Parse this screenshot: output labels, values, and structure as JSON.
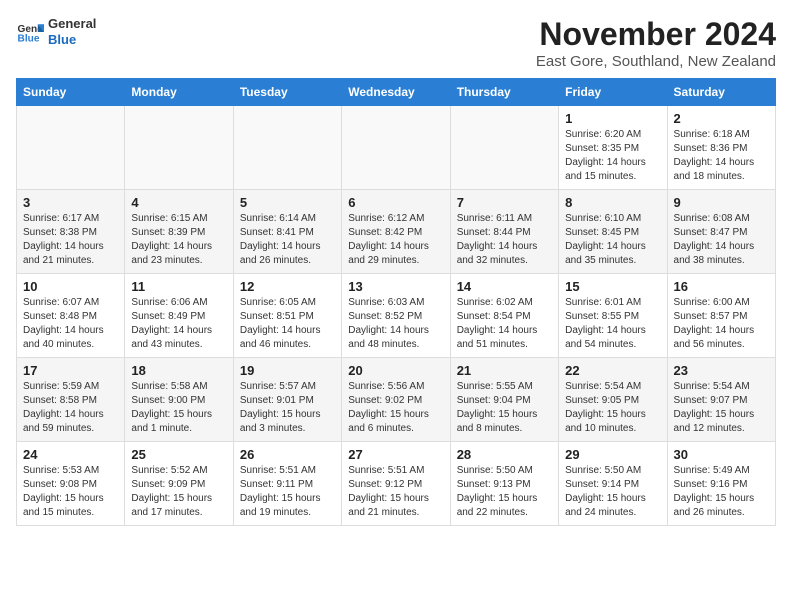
{
  "logo": {
    "line1": "General",
    "line2": "Blue"
  },
  "title": "November 2024",
  "subtitle": "East Gore, Southland, New Zealand",
  "days_header": [
    "Sunday",
    "Monday",
    "Tuesday",
    "Wednesday",
    "Thursday",
    "Friday",
    "Saturday"
  ],
  "weeks": [
    [
      {
        "day": "",
        "info": ""
      },
      {
        "day": "",
        "info": ""
      },
      {
        "day": "",
        "info": ""
      },
      {
        "day": "",
        "info": ""
      },
      {
        "day": "",
        "info": ""
      },
      {
        "day": "1",
        "info": "Sunrise: 6:20 AM\nSunset: 8:35 PM\nDaylight: 14 hours and 15 minutes."
      },
      {
        "day": "2",
        "info": "Sunrise: 6:18 AM\nSunset: 8:36 PM\nDaylight: 14 hours and 18 minutes."
      }
    ],
    [
      {
        "day": "3",
        "info": "Sunrise: 6:17 AM\nSunset: 8:38 PM\nDaylight: 14 hours and 21 minutes."
      },
      {
        "day": "4",
        "info": "Sunrise: 6:15 AM\nSunset: 8:39 PM\nDaylight: 14 hours and 23 minutes."
      },
      {
        "day": "5",
        "info": "Sunrise: 6:14 AM\nSunset: 8:41 PM\nDaylight: 14 hours and 26 minutes."
      },
      {
        "day": "6",
        "info": "Sunrise: 6:12 AM\nSunset: 8:42 PM\nDaylight: 14 hours and 29 minutes."
      },
      {
        "day": "7",
        "info": "Sunrise: 6:11 AM\nSunset: 8:44 PM\nDaylight: 14 hours and 32 minutes."
      },
      {
        "day": "8",
        "info": "Sunrise: 6:10 AM\nSunset: 8:45 PM\nDaylight: 14 hours and 35 minutes."
      },
      {
        "day": "9",
        "info": "Sunrise: 6:08 AM\nSunset: 8:47 PM\nDaylight: 14 hours and 38 minutes."
      }
    ],
    [
      {
        "day": "10",
        "info": "Sunrise: 6:07 AM\nSunset: 8:48 PM\nDaylight: 14 hours and 40 minutes."
      },
      {
        "day": "11",
        "info": "Sunrise: 6:06 AM\nSunset: 8:49 PM\nDaylight: 14 hours and 43 minutes."
      },
      {
        "day": "12",
        "info": "Sunrise: 6:05 AM\nSunset: 8:51 PM\nDaylight: 14 hours and 46 minutes."
      },
      {
        "day": "13",
        "info": "Sunrise: 6:03 AM\nSunset: 8:52 PM\nDaylight: 14 hours and 48 minutes."
      },
      {
        "day": "14",
        "info": "Sunrise: 6:02 AM\nSunset: 8:54 PM\nDaylight: 14 hours and 51 minutes."
      },
      {
        "day": "15",
        "info": "Sunrise: 6:01 AM\nSunset: 8:55 PM\nDaylight: 14 hours and 54 minutes."
      },
      {
        "day": "16",
        "info": "Sunrise: 6:00 AM\nSunset: 8:57 PM\nDaylight: 14 hours and 56 minutes."
      }
    ],
    [
      {
        "day": "17",
        "info": "Sunrise: 5:59 AM\nSunset: 8:58 PM\nDaylight: 14 hours and 59 minutes."
      },
      {
        "day": "18",
        "info": "Sunrise: 5:58 AM\nSunset: 9:00 PM\nDaylight: 15 hours and 1 minute."
      },
      {
        "day": "19",
        "info": "Sunrise: 5:57 AM\nSunset: 9:01 PM\nDaylight: 15 hours and 3 minutes."
      },
      {
        "day": "20",
        "info": "Sunrise: 5:56 AM\nSunset: 9:02 PM\nDaylight: 15 hours and 6 minutes."
      },
      {
        "day": "21",
        "info": "Sunrise: 5:55 AM\nSunset: 9:04 PM\nDaylight: 15 hours and 8 minutes."
      },
      {
        "day": "22",
        "info": "Sunrise: 5:54 AM\nSunset: 9:05 PM\nDaylight: 15 hours and 10 minutes."
      },
      {
        "day": "23",
        "info": "Sunrise: 5:54 AM\nSunset: 9:07 PM\nDaylight: 15 hours and 12 minutes."
      }
    ],
    [
      {
        "day": "24",
        "info": "Sunrise: 5:53 AM\nSunset: 9:08 PM\nDaylight: 15 hours and 15 minutes."
      },
      {
        "day": "25",
        "info": "Sunrise: 5:52 AM\nSunset: 9:09 PM\nDaylight: 15 hours and 17 minutes."
      },
      {
        "day": "26",
        "info": "Sunrise: 5:51 AM\nSunset: 9:11 PM\nDaylight: 15 hours and 19 minutes."
      },
      {
        "day": "27",
        "info": "Sunrise: 5:51 AM\nSunset: 9:12 PM\nDaylight: 15 hours and 21 minutes."
      },
      {
        "day": "28",
        "info": "Sunrise: 5:50 AM\nSunset: 9:13 PM\nDaylight: 15 hours and 22 minutes."
      },
      {
        "day": "29",
        "info": "Sunrise: 5:50 AM\nSunset: 9:14 PM\nDaylight: 15 hours and 24 minutes."
      },
      {
        "day": "30",
        "info": "Sunrise: 5:49 AM\nSunset: 9:16 PM\nDaylight: 15 hours and 26 minutes."
      }
    ]
  ]
}
